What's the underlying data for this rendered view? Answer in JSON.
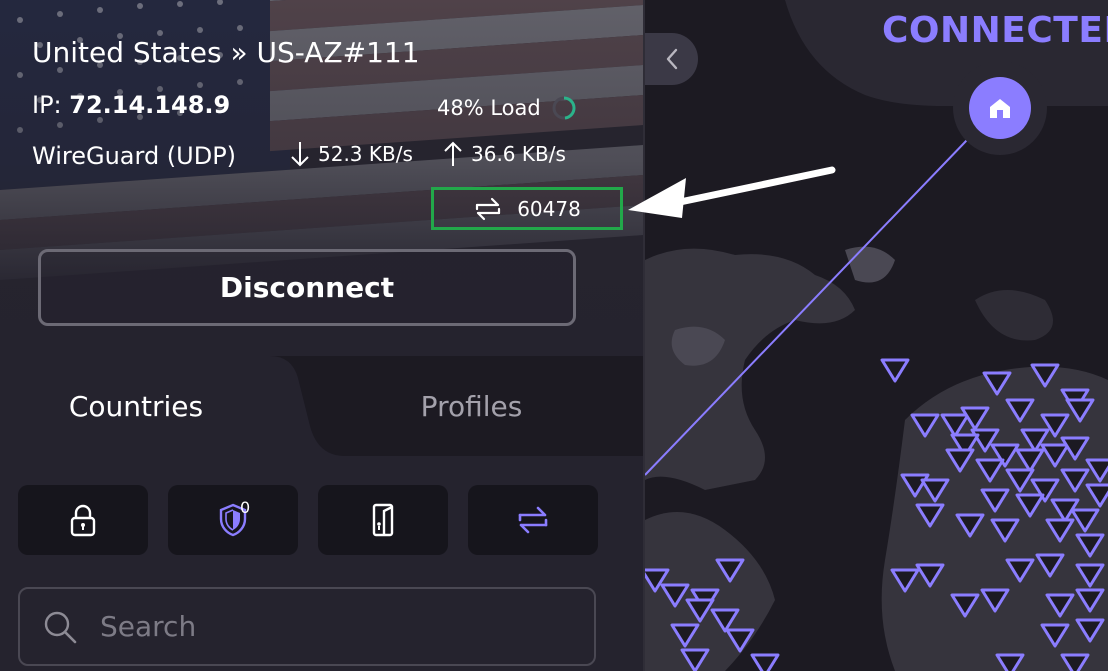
{
  "connection": {
    "location": "United States » US-AZ#111",
    "ip_label": "IP: ",
    "ip_value": "72.14.148.9",
    "load_text": "48% Load",
    "load_percent": 48,
    "protocol": "WireGuard (UDP)",
    "download_speed": "52.3 KB/s",
    "upload_speed": "36.6 KB/s",
    "port": "60478"
  },
  "actions": {
    "disconnect_label": "Disconnect"
  },
  "tabs": [
    {
      "label": "Countries",
      "active": true
    },
    {
      "label": "Profiles",
      "active": false
    }
  ],
  "quick_buttons": [
    {
      "icon": "lock-icon"
    },
    {
      "icon": "shield-icon",
      "badge": "0"
    },
    {
      "icon": "kill-switch-icon"
    },
    {
      "icon": "port-forwarding-icon"
    }
  ],
  "search": {
    "placeholder": "Search"
  },
  "map": {
    "status": "CONNECTED"
  },
  "colors": {
    "accent": "#8b7dff",
    "highlight_box": "#22a84a",
    "load_ring": "#2bb38a",
    "panel": "#25232e",
    "map_bg": "#1c1a22"
  }
}
